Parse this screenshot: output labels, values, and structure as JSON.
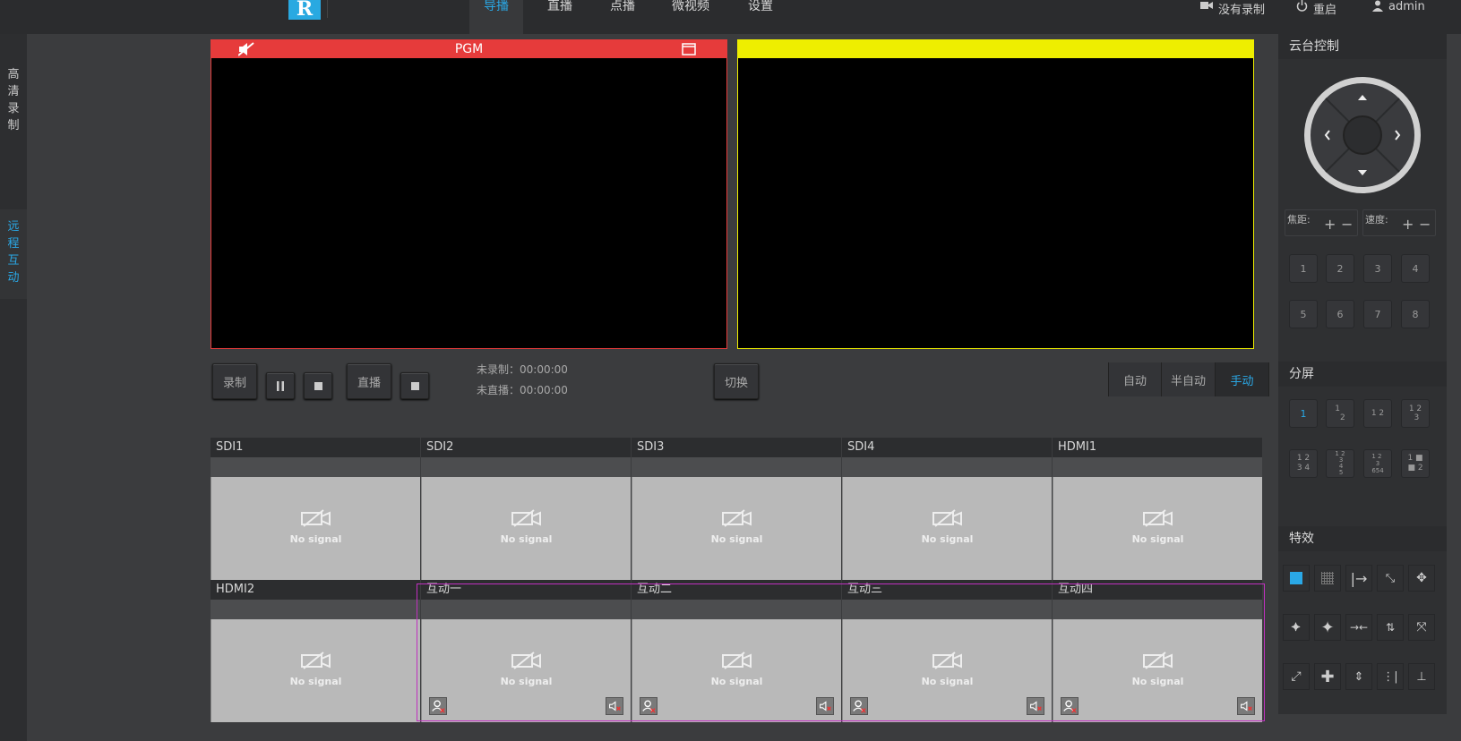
{
  "header": {
    "logo_text": "R",
    "nav": [
      "导播",
      "直播",
      "点播",
      "微视频",
      "设置"
    ],
    "record_status": "没有录制",
    "restart": "重启",
    "user": "admin"
  },
  "sidebar": {
    "items": [
      {
        "label": "高清录制"
      },
      {
        "label": "远程互动"
      }
    ]
  },
  "monitors": {
    "pgm_label": "PGM"
  },
  "controls": {
    "record": "录制",
    "live": "直播",
    "switch": "切换",
    "rec_status_label": "未录制：",
    "rec_time": "00:00:00",
    "live_status_label": "未直播：",
    "live_time": "00:00:00",
    "modes": [
      "自动",
      "半自动",
      "手动"
    ],
    "active_mode": "手动"
  },
  "sources": {
    "row1": [
      "SDI1",
      "SDI2",
      "SDI3",
      "SDI4",
      "HDMI1"
    ],
    "row2": [
      "HDMI2",
      "互动一",
      "互动二",
      "互动三",
      "互动四"
    ],
    "no_signal": "No signal"
  },
  "ptz": {
    "title": "云台控制",
    "focus_label": "焦距:",
    "speed_label": "速度:",
    "presets": [
      "1",
      "2",
      "3",
      "4",
      "5",
      "6",
      "7",
      "8"
    ]
  },
  "split": {
    "title": "分屏"
  },
  "effects": {
    "title": "特效"
  },
  "colors": {
    "accent": "#2aa8e6",
    "pgm": "#e63b3b",
    "pvw": "#eeee00",
    "interactive_frame": "#c030c0"
  }
}
